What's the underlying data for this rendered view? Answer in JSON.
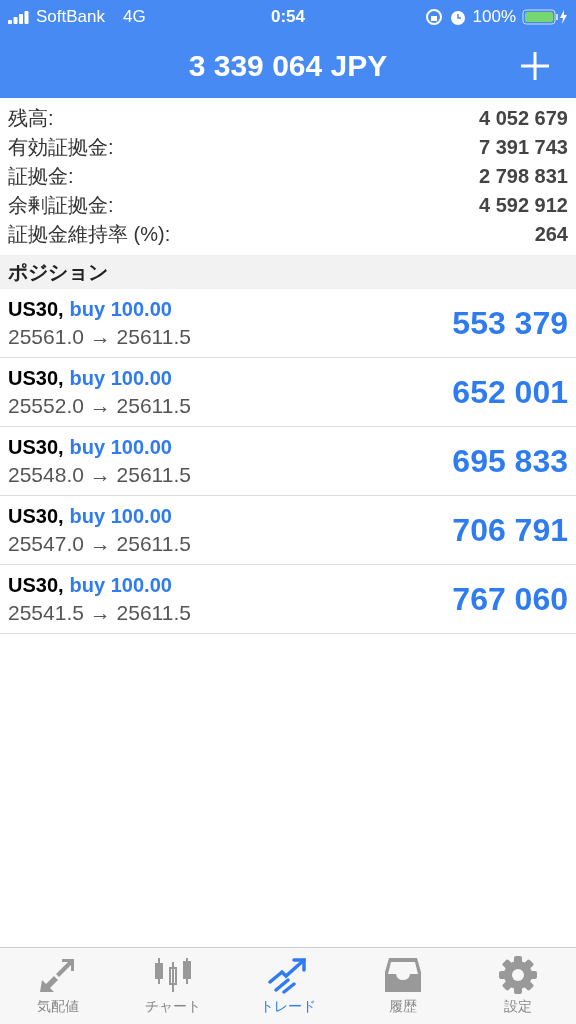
{
  "status_bar": {
    "carrier": "SoftBank",
    "network": "4G",
    "time": "0:54",
    "battery": "100%"
  },
  "header": {
    "title": "3 339 064 JPY"
  },
  "summary": [
    {
      "label": "残高:",
      "value": "4 052 679"
    },
    {
      "label": "有効証拠金:",
      "value": "7 391 743"
    },
    {
      "label": "証拠金:",
      "value": "2 798 831"
    },
    {
      "label": "余剰証拠金:",
      "value": "4 592 912"
    },
    {
      "label": "証拠金維持率 (%):",
      "value": "264"
    }
  ],
  "positions_section": {
    "title": "ポジション"
  },
  "positions": [
    {
      "symbol": "US30,",
      "order": "buy 100.00",
      "prices": "25561.0 → 25611.5",
      "profit": "553 379"
    },
    {
      "symbol": "US30,",
      "order": "buy 100.00",
      "prices": "25552.0 → 25611.5",
      "profit": "652 001"
    },
    {
      "symbol": "US30,",
      "order": "buy 100.00",
      "prices": "25548.0 → 25611.5",
      "profit": "695 833"
    },
    {
      "symbol": "US30,",
      "order": "buy 100.00",
      "prices": "25547.0 → 25611.5",
      "profit": "706 791"
    },
    {
      "symbol": "US30,",
      "order": "buy 100.00",
      "prices": "25541.5 → 25611.5",
      "profit": "767 060"
    }
  ],
  "tab_bar": [
    {
      "kind": "quotes",
      "label": "気配値",
      "selected": false
    },
    {
      "kind": "chart",
      "label": "チャート",
      "selected": false
    },
    {
      "kind": "trade",
      "label": "トレード",
      "selected": true
    },
    {
      "kind": "history",
      "label": "履歴",
      "selected": false
    },
    {
      "kind": "settings",
      "label": "設定",
      "selected": false
    }
  ]
}
